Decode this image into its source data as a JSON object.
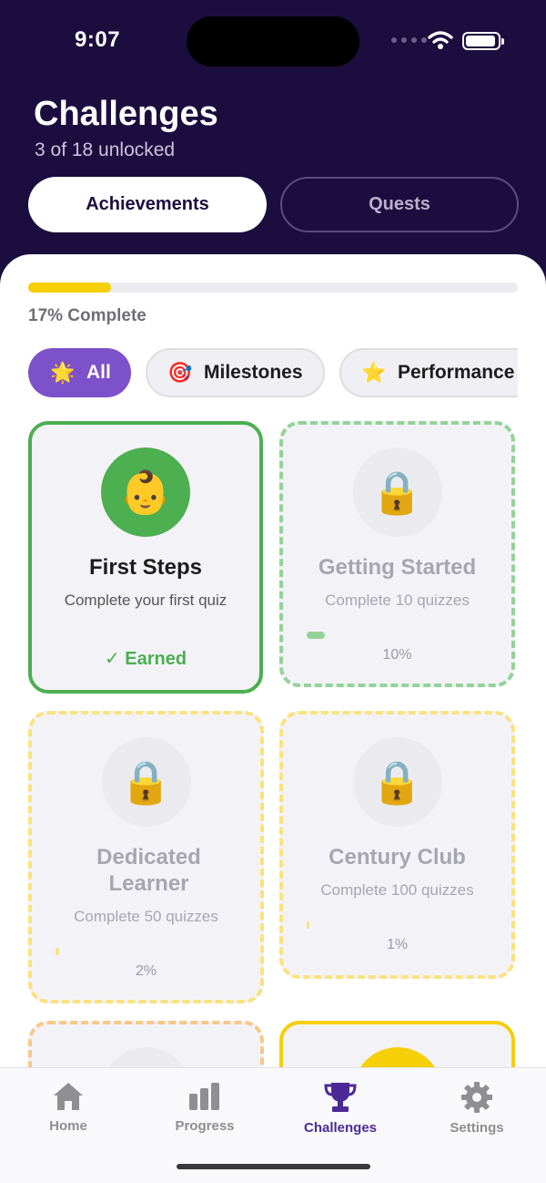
{
  "status_bar": {
    "time": "9:07"
  },
  "header": {
    "title": "Challenges",
    "subtitle": "3 of 18 unlocked",
    "tabs": [
      {
        "label": "Achievements",
        "active": true
      },
      {
        "label": "Quests",
        "active": false
      }
    ]
  },
  "progress": {
    "fraction": 0.17,
    "label": "17% Complete"
  },
  "filters": [
    {
      "emoji": "🌟",
      "label": "All",
      "selected": true
    },
    {
      "emoji": "🎯",
      "label": "Milestones",
      "selected": false
    },
    {
      "emoji": "⭐",
      "label": "Performance",
      "selected": false
    }
  ],
  "achievements": [
    {
      "icon": "👶",
      "title": "First Steps",
      "description": "Complete your first quiz",
      "status": "✓ Earned",
      "earned": true
    },
    {
      "icon": "🔒",
      "title": "Getting Started",
      "description": "Complete 10 quizzes",
      "progress": 0.1,
      "progress_label": "10%",
      "earned": false
    },
    {
      "icon": "🔒",
      "title": "Dedicated Learner",
      "description": "Complete 50 quizzes",
      "progress": 0.02,
      "progress_label": "2%",
      "earned": false
    },
    {
      "icon": "🔒",
      "title": "Century Club",
      "description": "Complete 100 quizzes",
      "progress": 0.01,
      "progress_label": "1%",
      "earned": false
    }
  ],
  "tab_bar": [
    {
      "label": "Home",
      "icon": "home-icon"
    },
    {
      "label": "Progress",
      "icon": "bar-chart-icon"
    },
    {
      "label": "Challenges",
      "icon": "trophy-icon",
      "active": true
    },
    {
      "label": "Settings",
      "icon": "gear-icon"
    }
  ],
  "colors": {
    "header_bg": "#1c0d3f",
    "accent_purple": "#7c51c9",
    "earned_green": "#4caf50",
    "progress_yellow": "#f5cf07"
  }
}
